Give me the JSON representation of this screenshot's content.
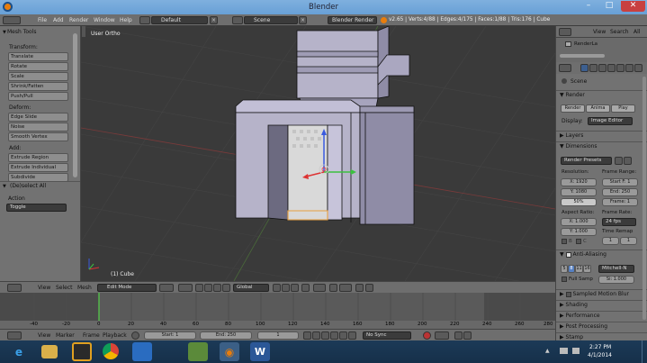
{
  "window": {
    "title": "Blender",
    "minimize": "–",
    "maximize": "□",
    "close": "✕"
  },
  "infobar": {
    "menus": [
      "File",
      "Add",
      "Render",
      "Window",
      "Help"
    ],
    "layout": "Default",
    "scene": "Scene",
    "engine": "Blender Render",
    "stats": "v2.65 | Verts:4/88 | Edges:4/175 | Faces:1/88 | Tris:176 | Cube"
  },
  "toolshelf": {
    "title": "Mesh Tools",
    "transform_label": "Transform:",
    "transform": [
      "Translate",
      "Rotate",
      "Scale",
      "Shrink/Fatten",
      "Push/Pull"
    ],
    "deform_label": "Deform:",
    "deform": [
      "Edge Slide",
      "Noise",
      "Smooth Vertex"
    ],
    "add_label": "Add:",
    "add": [
      "Extrude Region",
      "Extrude Individual",
      "Subdivide"
    ],
    "op_title": "(De)select All",
    "action_label": "Action",
    "action_value": "Toggle"
  },
  "viewport": {
    "view_label": "User Ortho",
    "object_label": "(1) Cube"
  },
  "vp_header": {
    "view": "View",
    "select": "Select",
    "mesh": "Mesh",
    "mode": "Edit Mode",
    "orientation": "Global"
  },
  "timeline": {
    "ticks": [
      "-40",
      "-20",
      "0",
      "20",
      "40",
      "60",
      "80",
      "100",
      "120",
      "140",
      "160",
      "180",
      "200",
      "220",
      "240",
      "260",
      "280"
    ]
  },
  "tl_header": {
    "view": "View",
    "marker": "Marker",
    "frame": "Frame",
    "playback": "Playback",
    "start": "Start: 1",
    "end": "End: 250",
    "current": "1",
    "sync": "No Sync"
  },
  "outliner": {
    "view": "View",
    "search": "Search",
    "all": "All",
    "render_layers": "RenderLa"
  },
  "properties": {
    "scene": "Scene",
    "render_section": "Render",
    "render_btn": "Render",
    "anim_btn": "Anima",
    "play_btn": "Play",
    "display_label": "Display:",
    "display_value": "Image Editor",
    "layers": "Layers",
    "dimensions": "Dimensions",
    "presets": "Render Presets",
    "resolution": "Resolution:",
    "res_x": "X: 1920",
    "res_y": "Y: 1080",
    "res_pct": "50%",
    "frame_range": "Frame Range:",
    "start_f": "Start F: 1",
    "end_f": "End: 250",
    "frame": "Frame: 1",
    "aspect": "Aspect Ratio:",
    "asp_x": "X: 1.000",
    "asp_y": "Y: 1.000",
    "frame_rate": "Frame Rate:",
    "fps": "24 fps",
    "time_remap": "Time Remap",
    "remap_a": "1",
    "remap_b": "1",
    "b": "B",
    "c": "C",
    "aa": "Anti-Aliasing",
    "aa_samples": [
      "5",
      "8",
      "11",
      "16"
    ],
    "aa_filter": "Mitchell-N",
    "full_sample": "Full Samp",
    "size": "Si: 1.000",
    "sampled_motion": "Sampled Motion Blur",
    "shading": "Shading",
    "performance": "Performance",
    "post": "Post Processing",
    "stamp": "Stamp"
  },
  "taskbar": {
    "time": "2:27 PM",
    "date": "4/1/2014"
  },
  "colors": {
    "accent_orange": "#e8a040",
    "timeline_cursor": "#53b84a",
    "title_blue": "#6aa2d8"
  }
}
